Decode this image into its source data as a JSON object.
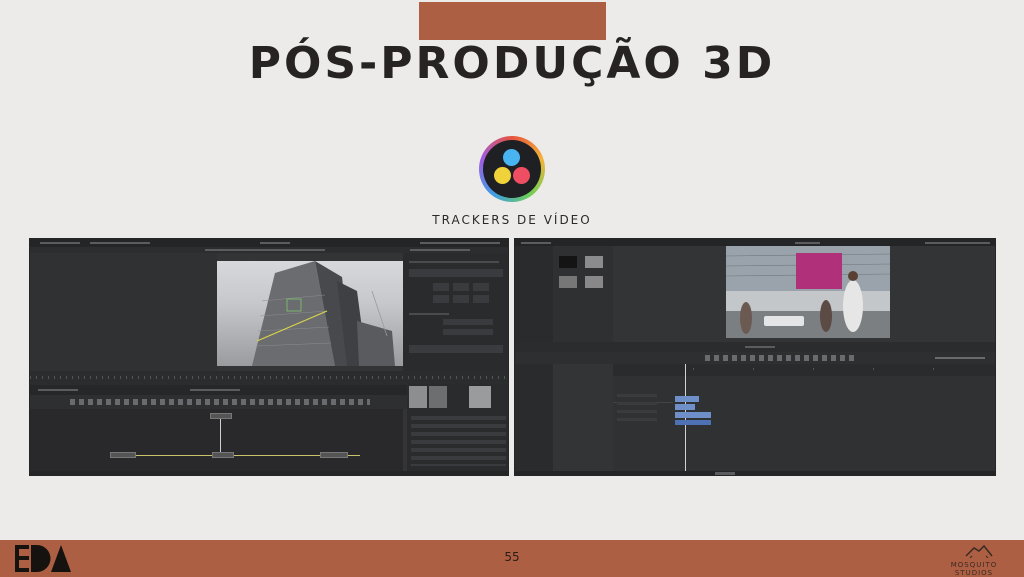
{
  "slide": {
    "title": "PÓS-PRODUÇÃO 3D",
    "subtitle": "TRACKERS DE VÍDEO",
    "page_number": "55"
  },
  "brand": {
    "name": "MOSQUITO STUDIOS"
  },
  "logo": {
    "name": "davinci-resolve-logo"
  },
  "colors": {
    "accent": "#ad5f43",
    "background": "#ecebea",
    "title_text": "#262322",
    "editor_bg": "#333436"
  },
  "screenshots": {
    "left": {
      "description_label": "Fusion page tracker"
    },
    "right": {
      "description_label": "Edit page timeline"
    }
  }
}
